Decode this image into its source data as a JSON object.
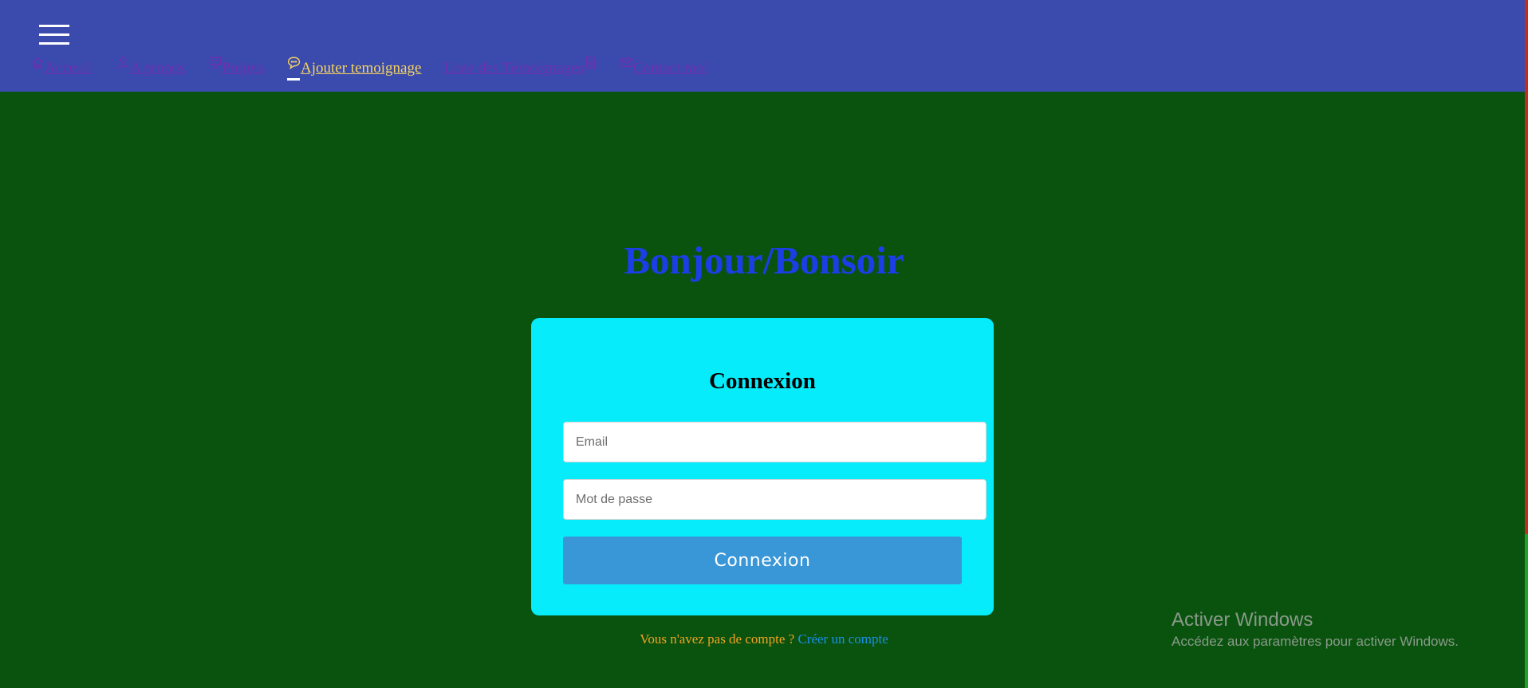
{
  "header": {
    "menu_icon": "hamburger-menu-icon",
    "nav": [
      {
        "label": "Acceuil",
        "icon": "home-icon",
        "active": false
      },
      {
        "label": "A propos",
        "icon": "user-icon",
        "active": false
      },
      {
        "label": "Projets",
        "icon": "presentation-icon",
        "active": false
      },
      {
        "label": "Ajouter temoignage",
        "icon": "chat-bubble-icon",
        "active": true
      },
      {
        "label": "Liste des Témoignages",
        "icon": "document-list-icon",
        "active": false
      },
      {
        "label": "Contact moi",
        "icon": "mail-icon",
        "active": false
      }
    ]
  },
  "main": {
    "greeting": "Bonjour/Bonsoir",
    "login": {
      "title": "Connexion",
      "email_placeholder": "Email",
      "email_value": "",
      "password_placeholder": "Mot de passe",
      "password_value": "",
      "submit_label": "Connexion"
    },
    "signup": {
      "prompt": "Vous n'avez pas de compte ?",
      "link_label": "Créer un compte"
    }
  },
  "watermark": {
    "title": "Activer Windows",
    "subtitle": "Accédez aux paramètres pour activer Windows."
  },
  "colors": {
    "header_bg": "#3a4bad",
    "page_bg": "#0a530f",
    "card_bg": "#06ecfb",
    "greeting": "#1c3ee6",
    "nav_link": "#6e2fae",
    "nav_active": "#f7d35e",
    "button_bg": "#3997d8",
    "signup_prompt": "#f3a21f",
    "signup_link": "#1a8fe8"
  }
}
